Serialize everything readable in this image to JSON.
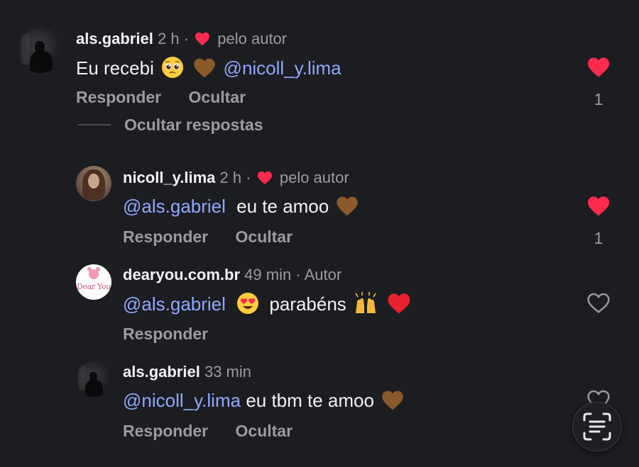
{
  "colors": {
    "background": "#1c1d21",
    "text": "#f2f2f4",
    "muted": "#9a9ba3",
    "mention": "#8fa8ff",
    "like_red": "#ff2b4f"
  },
  "comments": [
    {
      "username": "als.gabriel",
      "time": "2 h",
      "separator": "·",
      "badge": "pelo autor",
      "text": [
        "Eu recebi"
      ],
      "emojis": [
        "pleading-face",
        "brown-heart"
      ],
      "mention": "@nicoll_y.lima",
      "actions": [
        "Responder",
        "Ocultar"
      ],
      "liked": true,
      "like_count": "1"
    },
    {
      "username": "nicoll_y.lima",
      "time": "2 h",
      "separator": "·",
      "badge": "pelo autor",
      "mention": "@als.gabriel",
      "text": "eu te amoo",
      "emojis": [
        "brown-heart"
      ],
      "actions": [
        "Responder",
        "Ocultar"
      ],
      "liked": true,
      "like_count": "1"
    },
    {
      "username": "dearyou.com.br",
      "time": "49 min",
      "separator": "·",
      "badge": "Autor",
      "mention": "@als.gabriel",
      "text": "parabéns",
      "emojis": [
        "heart-eyes-face",
        "raising-hands",
        "red-heart"
      ],
      "actions": [
        "Responder"
      ],
      "liked": false,
      "avatar_text": "Dear You"
    },
    {
      "username": "als.gabriel",
      "time": "33 min",
      "mention": "@nicoll_y.lima",
      "text": "eu tbm te amoo",
      "emojis": [
        "brown-heart"
      ],
      "actions": [
        "Responder",
        "Ocultar"
      ],
      "liked": false
    }
  ],
  "hide_replies_label": "Ocultar respostas",
  "fab_icon": "text-scan-icon"
}
